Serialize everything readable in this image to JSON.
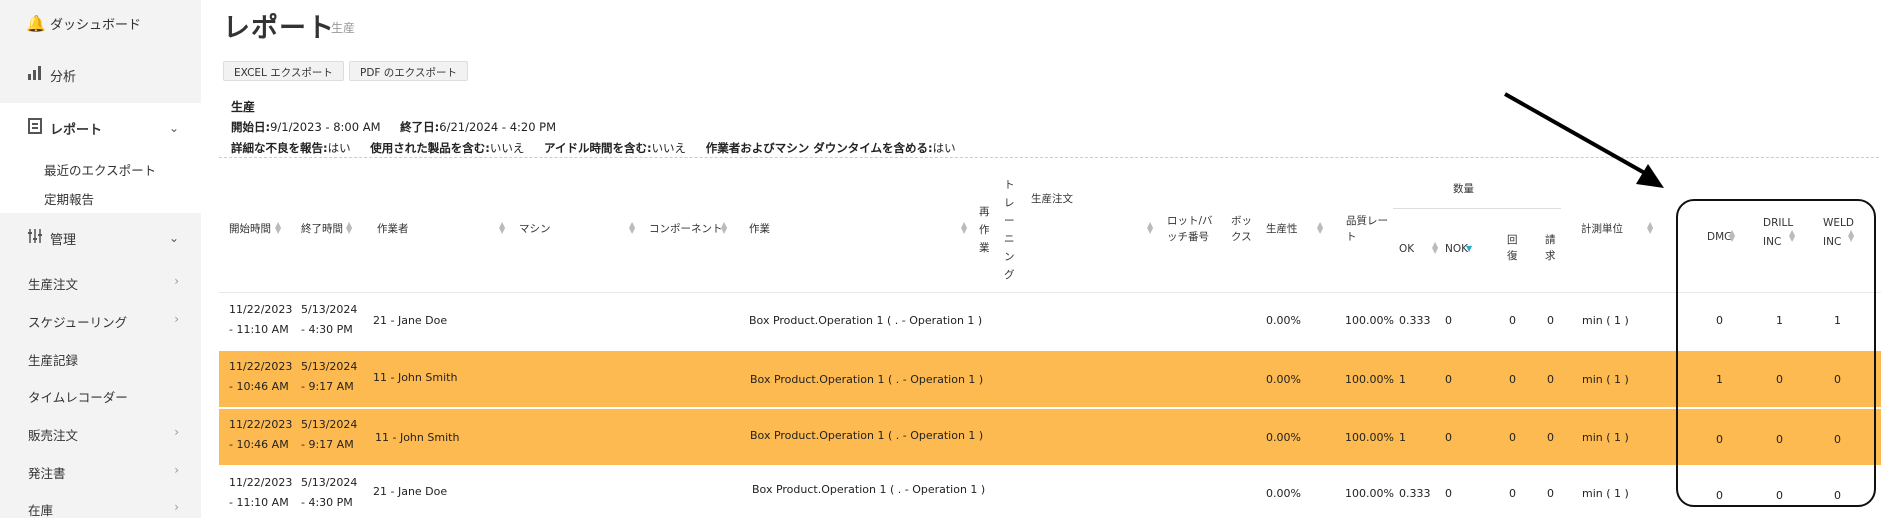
{
  "sidebar": {
    "dashboard": {
      "label": "ダッシュボード",
      "icon": "bell-icon"
    },
    "analysis": {
      "label": "分析",
      "icon": "bar-chart-icon"
    },
    "reports": {
      "label": "レポート",
      "icon": "report-icon"
    },
    "reports_sub": [
      "最近のエクスポート",
      "定期報告"
    ],
    "admin": {
      "label": "管理",
      "icon": "sliders-icon"
    },
    "items": [
      "生産注文",
      "スケジューリング",
      "生産記録",
      "タイムレコーダー",
      "販売注文",
      "発注書",
      "在庫"
    ]
  },
  "page": {
    "title": "レポート",
    "subtitle": "生産"
  },
  "buttons": {
    "excel": "EXCEL エクスポート",
    "pdf": "PDF のエクスポート"
  },
  "info": {
    "heading": "生産",
    "start_label": "開始日:",
    "start_value": "9/1/2023 - 8:00 AM",
    "end_label": "終了日:",
    "end_value": "6/21/2024 - 4:20 PM",
    "defect_label": "詳細な不良を報告:",
    "defect_value": "はい",
    "used_label": "使用された製品を含む:",
    "used_value": "いいえ",
    "idle_label": "アイドル時間を含む:",
    "idle_value": "いいえ",
    "downtime_label": "作業者およびマシン ダウンタイムを含める:",
    "downtime_value": "はい"
  },
  "table": {
    "headers": {
      "start": "開始時間",
      "end": "終了時間",
      "operator": "作業者",
      "machine": "マシン",
      "component": "コンポーネント",
      "operation": "作業",
      "rework": "再作業",
      "training": "トレーニング",
      "order": "生産注文",
      "lot": "ロット/バッチ番号",
      "box": "ボックス",
      "productivity": "生産性",
      "quality": "品質レート",
      "quantity": "数量",
      "ok": "OK",
      "nok": "NOK",
      "recover": "回復",
      "claim": "請求",
      "unit": "計測単位",
      "dmg": "DMG",
      "drill": "DRILL INC",
      "weld": "WELD INC"
    },
    "rows": [
      {
        "start_date": "11/22/2023",
        "start_time": "- 11:10 AM",
        "end_date": "5/13/2024",
        "end_time": "- 4:30 PM",
        "operator": "21 - Jane Doe",
        "operation": "Box Product.Operation 1 ( . - Operation 1 )",
        "productivity": "0.00%",
        "quality": "100.00%",
        "ok": "0.333",
        "nok": "0",
        "recover": "0",
        "claim": "0",
        "unit": "min ( 1 )",
        "dmg": "0",
        "drill": "1",
        "weld": "1",
        "highlight": false
      },
      {
        "start_date": "11/22/2023",
        "start_time": "- 10:46 AM",
        "end_date": "5/13/2024",
        "end_time": "- 9:17 AM",
        "operator": "11 - John Smith",
        "operation": "Box Product.Operation 1 ( . - Operation 1 )",
        "productivity": "0.00%",
        "quality": "100.00%",
        "ok": "1",
        "nok": "0",
        "recover": "0",
        "claim": "0",
        "unit": "min ( 1 )",
        "dmg": "1",
        "drill": "0",
        "weld": "0",
        "highlight": true
      },
      {
        "start_date": "11/22/2023",
        "start_time": "- 10:46 AM",
        "end_date": "5/13/2024",
        "end_time": "- 9:17 AM",
        "operator": "11 - John Smith",
        "operation": "Box Product.Operation 1 ( . - Operation 1 )",
        "productivity": "0.00%",
        "quality": "100.00%",
        "ok": "1",
        "nok": "0",
        "recover": "0",
        "claim": "0",
        "unit": "min ( 1 )",
        "dmg": "0",
        "drill": "0",
        "weld": "0",
        "highlight": true
      },
      {
        "start_date": "11/22/2023",
        "start_time": "- 11:10 AM",
        "end_date": "5/13/2024",
        "end_time": "- 4:30 PM",
        "operator": "21 - Jane Doe",
        "operation": "Box Product.Operation 1 ( . - Operation 1 )",
        "productivity": "0.00%",
        "quality": "100.00%",
        "ok": "0.333",
        "nok": "0",
        "recover": "0",
        "claim": "0",
        "unit": "min ( 1 )",
        "dmg": "0",
        "drill": "0",
        "weld": "0",
        "highlight": false
      }
    ]
  },
  "colors": {
    "highlight": "#fdba51",
    "sidebar_bg": "#f3f3f3",
    "sort_active": "#2aa7c9"
  }
}
